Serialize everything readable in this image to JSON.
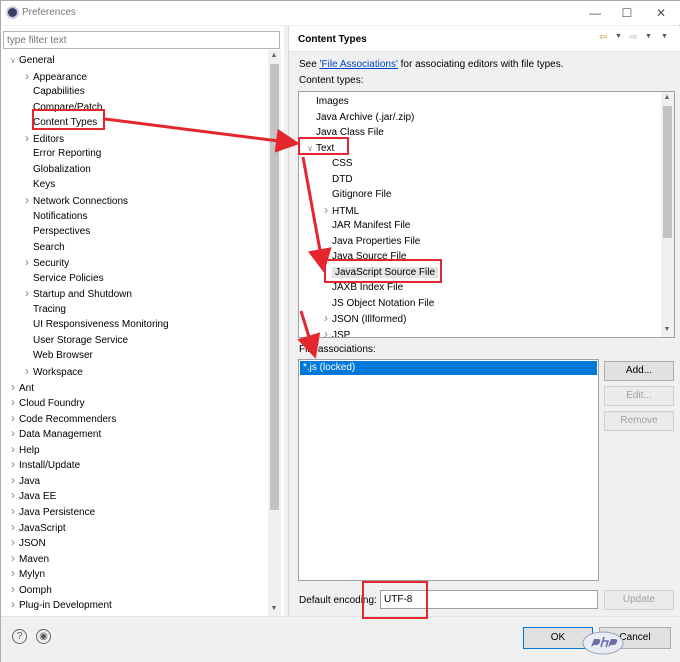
{
  "window": {
    "title": "Preferences"
  },
  "filter": {
    "placeholder": "type filter text"
  },
  "tree": {
    "items": [
      {
        "label": "General",
        "level": 0,
        "twisty": "expanded"
      },
      {
        "label": "Appearance",
        "level": 1,
        "twisty": "collapsed"
      },
      {
        "label": "Capabilities",
        "level": 1,
        "twisty": ""
      },
      {
        "label": "Compare/Patch",
        "level": 1,
        "twisty": ""
      },
      {
        "label": "Content Types",
        "level": 1,
        "twisty": "",
        "selected": true
      },
      {
        "label": "Editors",
        "level": 1,
        "twisty": "collapsed"
      },
      {
        "label": "Error Reporting",
        "level": 1,
        "twisty": ""
      },
      {
        "label": "Globalization",
        "level": 1,
        "twisty": ""
      },
      {
        "label": "Keys",
        "level": 1,
        "twisty": ""
      },
      {
        "label": "Network Connections",
        "level": 1,
        "twisty": "collapsed"
      },
      {
        "label": "Notifications",
        "level": 1,
        "twisty": ""
      },
      {
        "label": "Perspectives",
        "level": 1,
        "twisty": ""
      },
      {
        "label": "Search",
        "level": 1,
        "twisty": ""
      },
      {
        "label": "Security",
        "level": 1,
        "twisty": "collapsed"
      },
      {
        "label": "Service Policies",
        "level": 1,
        "twisty": ""
      },
      {
        "label": "Startup and Shutdown",
        "level": 1,
        "twisty": "collapsed"
      },
      {
        "label": "Tracing",
        "level": 1,
        "twisty": ""
      },
      {
        "label": "UI Responsiveness Monitoring",
        "level": 1,
        "twisty": ""
      },
      {
        "label": "User Storage Service",
        "level": 1,
        "twisty": ""
      },
      {
        "label": "Web Browser",
        "level": 1,
        "twisty": ""
      },
      {
        "label": "Workspace",
        "level": 1,
        "twisty": "collapsed"
      },
      {
        "label": "Ant",
        "level": 0,
        "twisty": "collapsed"
      },
      {
        "label": "Cloud Foundry",
        "level": 0,
        "twisty": "collapsed"
      },
      {
        "label": "Code Recommenders",
        "level": 0,
        "twisty": "collapsed"
      },
      {
        "label": "Data Management",
        "level": 0,
        "twisty": "collapsed"
      },
      {
        "label": "Help",
        "level": 0,
        "twisty": "collapsed"
      },
      {
        "label": "Install/Update",
        "level": 0,
        "twisty": "collapsed"
      },
      {
        "label": "Java",
        "level": 0,
        "twisty": "collapsed"
      },
      {
        "label": "Java EE",
        "level": 0,
        "twisty": "collapsed"
      },
      {
        "label": "Java Persistence",
        "level": 0,
        "twisty": "collapsed"
      },
      {
        "label": "JavaScript",
        "level": 0,
        "twisty": "collapsed"
      },
      {
        "label": "JSON",
        "level": 0,
        "twisty": "collapsed"
      },
      {
        "label": "Maven",
        "level": 0,
        "twisty": "collapsed"
      },
      {
        "label": "Mylyn",
        "level": 0,
        "twisty": "collapsed"
      },
      {
        "label": "Oomph",
        "level": 0,
        "twisty": "collapsed"
      },
      {
        "label": "Plug-in Development",
        "level": 0,
        "twisty": "collapsed"
      }
    ]
  },
  "page": {
    "title": "Content Types",
    "desc_prefix": "See ",
    "desc_link": "'File Associations'",
    "desc_suffix": " for associating editors with file types.",
    "content_types_label": "Content types:",
    "file_associations_label": "File associations:",
    "encoding_label": "Default encoding:"
  },
  "content_types": [
    {
      "label": "Images",
      "level": 0,
      "twisty": ""
    },
    {
      "label": "Java Archive (.jar/.zip)",
      "level": 0,
      "twisty": ""
    },
    {
      "label": "Java Class File",
      "level": 0,
      "twisty": ""
    },
    {
      "label": "Text",
      "level": 0,
      "twisty": "expanded"
    },
    {
      "label": "CSS",
      "level": 1,
      "twisty": ""
    },
    {
      "label": "DTD",
      "level": 1,
      "twisty": ""
    },
    {
      "label": "Gitignore File",
      "level": 1,
      "twisty": ""
    },
    {
      "label": "HTML",
      "level": 1,
      "twisty": "collapsed"
    },
    {
      "label": "JAR Manifest File",
      "level": 1,
      "twisty": ""
    },
    {
      "label": "Java Properties File",
      "level": 1,
      "twisty": ""
    },
    {
      "label": "Java Source File",
      "level": 1,
      "twisty": ""
    },
    {
      "label": "JavaScript Source File",
      "level": 1,
      "twisty": "",
      "selected": true
    },
    {
      "label": "JAXB Index File",
      "level": 1,
      "twisty": ""
    },
    {
      "label": "JS Object Notation File",
      "level": 1,
      "twisty": ""
    },
    {
      "label": "JSON (Illformed)",
      "level": 1,
      "twisty": "collapsed"
    },
    {
      "label": "JSP",
      "level": 1,
      "twisty": "collapsed"
    }
  ],
  "file_associations": [
    "*.js (locked)"
  ],
  "buttons": {
    "add": "Add...",
    "edit": "Edit...",
    "remove": "Remove",
    "update": "Update",
    "ok": "OK",
    "cancel": "Cancel"
  },
  "encoding": {
    "value": "UTF-8"
  },
  "icons": {
    "back": "back-arrow-icon",
    "forward": "forward-arrow-icon",
    "menu": "view-menu-icon",
    "help": "help-icon",
    "import_export": "import-export-icon"
  },
  "colors": {
    "selection": "#0078d7",
    "annotation": "#e4272e",
    "link": "#0045c7"
  }
}
